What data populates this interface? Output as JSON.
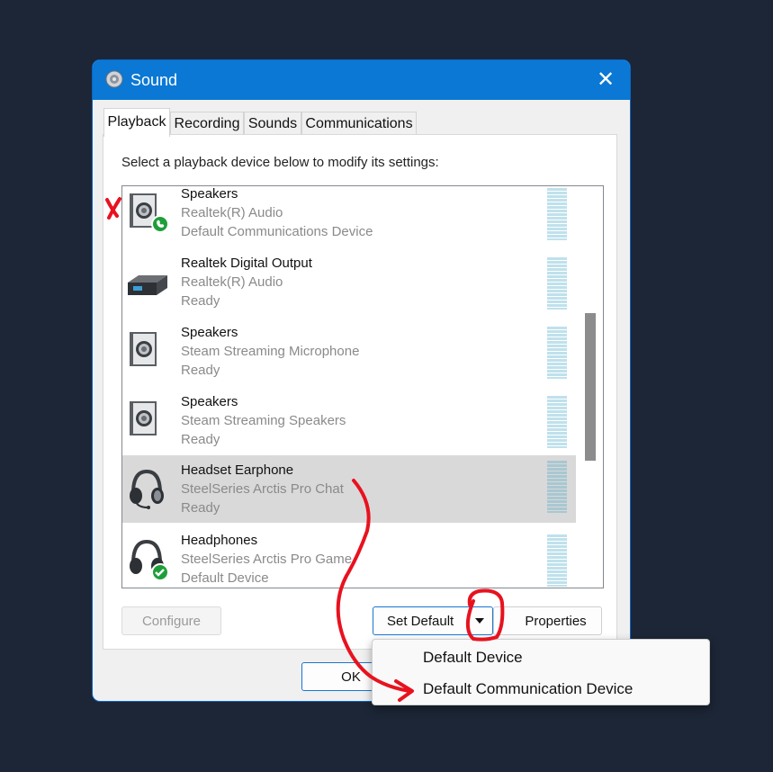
{
  "window": {
    "title": "Sound"
  },
  "tabs": [
    {
      "label": "Playback",
      "active": true
    },
    {
      "label": "Recording"
    },
    {
      "label": "Sounds"
    },
    {
      "label": "Communications"
    }
  ],
  "instruction": "Select a playback device below to modify its settings:",
  "devices": [
    {
      "name": "Speakers",
      "driver": "Realtek(R) Audio",
      "status": "Default Communications Device",
      "icon": "speaker-icon",
      "badge": "phone-badge-icon"
    },
    {
      "name": "Realtek Digital Output",
      "driver": "Realtek(R) Audio",
      "status": "Ready",
      "icon": "digital-output-icon"
    },
    {
      "name": "Speakers",
      "driver": "Steam Streaming Microphone",
      "status": "Ready",
      "icon": "speaker-icon"
    },
    {
      "name": "Speakers",
      "driver": "Steam Streaming Speakers",
      "status": "Ready",
      "icon": "speaker-icon"
    },
    {
      "name": "Headset Earphone",
      "driver": "SteelSeries Arctis Pro Chat",
      "status": "Ready",
      "icon": "headset-icon",
      "selected": true
    },
    {
      "name": "Headphones",
      "driver": "SteelSeries Arctis Pro Game",
      "status": "Default Device",
      "icon": "headphones-icon",
      "badge": "check-badge-icon"
    }
  ],
  "buttons": {
    "configure": "Configure",
    "set_default": "Set Default",
    "properties": "Properties",
    "ok": "OK"
  },
  "dropdown": {
    "items": [
      "Default Device",
      "Default Communication Device"
    ]
  },
  "colors": {
    "titlebar": "#0a78d4",
    "annotation": "#e8121f",
    "badge_green": "#1e9e3a"
  }
}
